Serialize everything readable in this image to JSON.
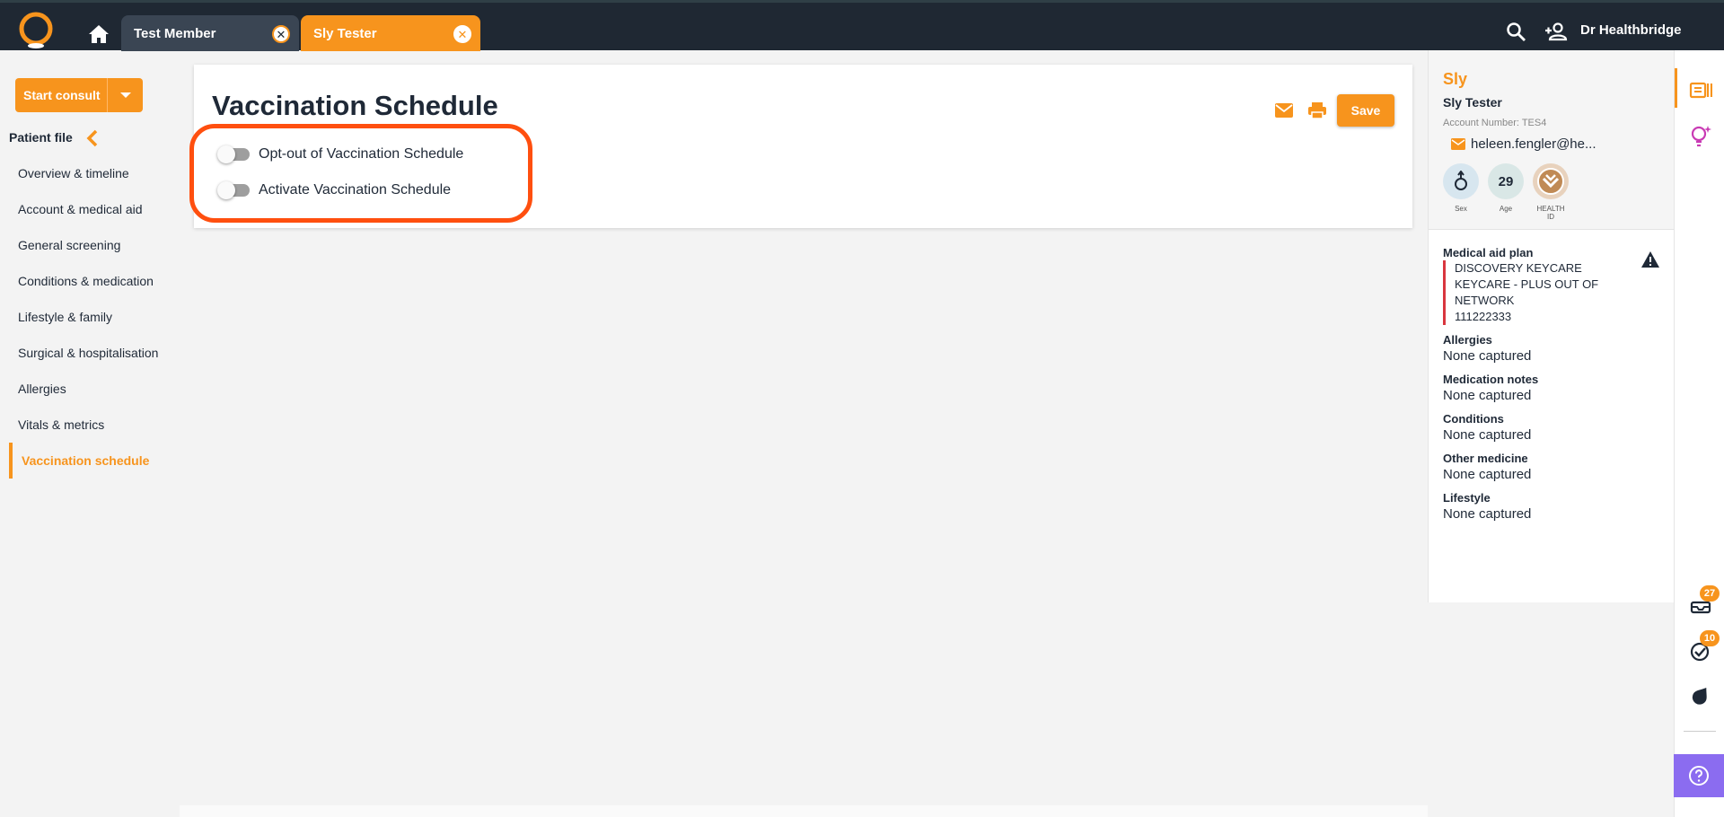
{
  "header": {
    "tabs": [
      {
        "label": "Test Member",
        "close_icon": "close-circle-icon"
      },
      {
        "label": "Sly Tester",
        "close_icon": "close-circle-icon",
        "active": true
      }
    ],
    "user_name": "Dr Healthbridge",
    "icons": [
      "logo-icon",
      "home-icon",
      "search-icon",
      "add-user-icon"
    ]
  },
  "sidebar": {
    "start_consult_label": "Start consult",
    "patient_file_label": "Patient file",
    "items": [
      {
        "label": "Overview & timeline"
      },
      {
        "label": "Account & medical aid"
      },
      {
        "label": "General screening"
      },
      {
        "label": "Conditions & medication"
      },
      {
        "label": "Lifestyle & family"
      },
      {
        "label": "Surgical & hospitalisation"
      },
      {
        "label": "Allergies"
      },
      {
        "label": "Vitals & metrics"
      },
      {
        "label": "Vaccination schedule",
        "active": true
      }
    ]
  },
  "main": {
    "title": "Vaccination Schedule",
    "save_label": "Save",
    "toggles": [
      {
        "label": "Opt-out of Vaccination Schedule",
        "checked": false
      },
      {
        "label": "Activate Vaccination Schedule",
        "checked": false
      }
    ]
  },
  "patient": {
    "first_name": "Sly",
    "full_name": "Sly Tester",
    "account_number": "Account Number: TES4",
    "email": "heleen.fengler@he...",
    "age": "29",
    "badges": {
      "sex": "Sex",
      "age": "Age",
      "health_id": "HEALTH ID"
    },
    "medical_aid_label": "Medical aid plan",
    "medical_aid_lines": [
      "DISCOVERY KEYCARE",
      "KEYCARE - PLUS OUT OF",
      "NETWORK",
      "111222333"
    ],
    "sections": [
      {
        "title": "Allergies",
        "value": "None captured"
      },
      {
        "title": "Medication notes",
        "value": "None captured"
      },
      {
        "title": "Conditions",
        "value": "None captured"
      },
      {
        "title": "Other medicine",
        "value": "None captured"
      },
      {
        "title": "Lifestyle",
        "value": "None captured"
      }
    ]
  },
  "rail": {
    "inbox_count": "27",
    "tasks_count": "10"
  },
  "colors": {
    "accent": "#f7941d",
    "topbar": "#1f2833",
    "highlight": "#ff4f0f",
    "help": "#8b6cf0",
    "alert_bar": "#d9363e"
  }
}
